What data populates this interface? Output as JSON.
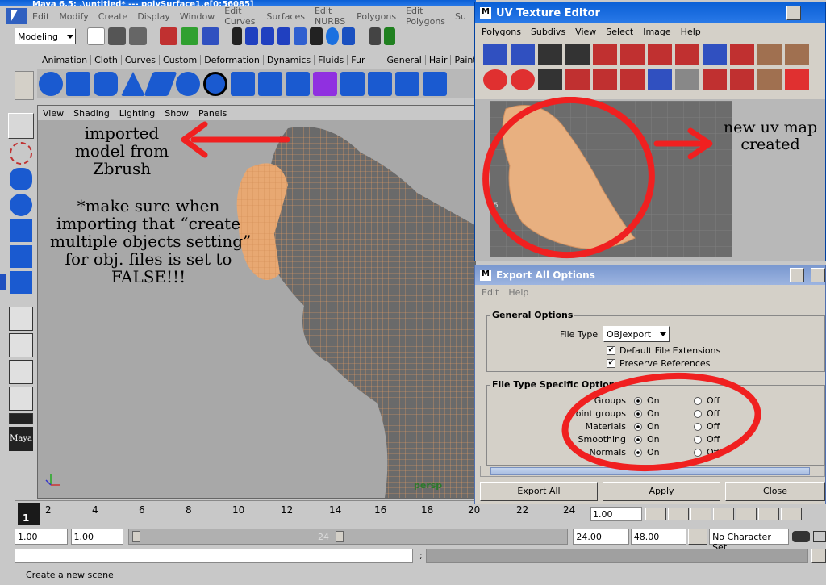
{
  "maya": {
    "title": "Maya 6.5: .\\untitled* --- polySurface1.e[0:56085]",
    "menu": [
      "Edit",
      "Modify",
      "Create",
      "Display",
      "Window",
      "Edit Curves",
      "Surfaces",
      "Edit NURBS",
      "Polygons",
      "Edit Polygons",
      "Su"
    ],
    "mode": "Modeling",
    "shelf_tabs": [
      "Animation",
      "Cloth",
      "Curves",
      "Custom",
      "Deformation",
      "Dynamics",
      "Fluids",
      "Fur",
      "General",
      "Hair",
      "PaintEffe"
    ],
    "panel_menu": [
      "View",
      "Shading",
      "Lighting",
      "Show",
      "Panels"
    ],
    "camera": "persp",
    "timeline_ticks": [
      "1",
      "2",
      "4",
      "6",
      "8",
      "10",
      "12",
      "14",
      "16",
      "18",
      "20",
      "22",
      "24"
    ],
    "current_frame_field": "1.00",
    "range": {
      "start": "1.00",
      "start2": "1.00",
      "end": "24.00",
      "end2": "48.00",
      "slider_end": "24"
    },
    "char_set": "No Character Set",
    "status": "Create a new scene",
    "cmd_sep": ";",
    "logo": "Maya"
  },
  "annotations": {
    "left": "imported\nmodel from\nZbrush",
    "note": "*make sure when\nimporting that “create\nmultiple objects setting”\nfor obj. files is set to\nFALSE!!!",
    "right": "new uv map\ncreated"
  },
  "uv_editor": {
    "title": "UV Texture Editor",
    "menu": [
      "Polygons",
      "Subdivs",
      "View",
      "Select",
      "Image",
      "Help"
    ],
    "axis_label": ".5"
  },
  "export": {
    "title": "Export All Options",
    "menu": [
      "Edit",
      "Help"
    ],
    "general": "General Options",
    "file_type_label": "File Type",
    "file_type": "OBJexport",
    "check1": "Default File Extensions",
    "check2": "Preserve References",
    "specific": "File Type Specific Options",
    "options": [
      {
        "label": "Groups",
        "on": "On",
        "off": "Off"
      },
      {
        "label": "Point groups",
        "on": "On",
        "off": "Off"
      },
      {
        "label": "Materials",
        "on": "On",
        "off": "Off"
      },
      {
        "label": "Smoothing",
        "on": "On",
        "off": "Off"
      },
      {
        "label": "Normals",
        "on": "On",
        "off": "Off"
      }
    ],
    "buttons": {
      "export": "Export All",
      "apply": "Apply",
      "close": "Close"
    }
  }
}
